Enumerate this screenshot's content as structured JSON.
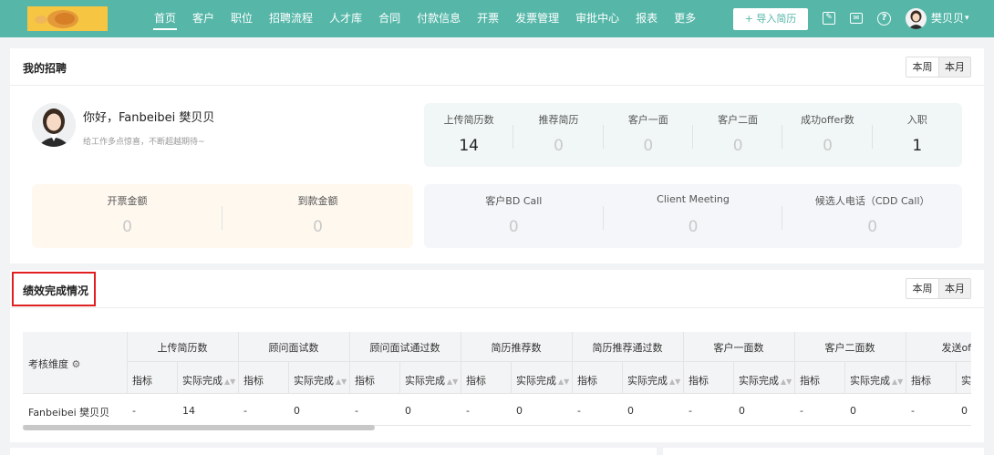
{
  "nav": {
    "items": [
      "首页",
      "客户",
      "职位",
      "招聘流程",
      "人才库",
      "合同",
      "付款信息",
      "开票",
      "发票管理",
      "审批中心",
      "报表",
      "更多"
    ],
    "active_index": 0,
    "import_label": "+ 导入简历",
    "user_name": "樊贝贝",
    "caret": "▾"
  },
  "recruit": {
    "title": "我的招聘",
    "toggle": [
      "本周",
      "本月"
    ],
    "greeting": "你好，Fanbeibei 樊贝贝",
    "slogan": "给工作多点惊喜，不断超越期待~",
    "top_stats": [
      {
        "label": "上传简历数",
        "value": "14"
      },
      {
        "label": "推荐简历",
        "value": "0"
      },
      {
        "label": "客户一面",
        "value": "0"
      },
      {
        "label": "客户二面",
        "value": "0"
      },
      {
        "label": "成功offer数",
        "value": "0"
      },
      {
        "label": "入职",
        "value": "1"
      }
    ],
    "money_stats": [
      {
        "label": "开票金额",
        "value": "0"
      },
      {
        "label": "到款金额",
        "value": "0"
      }
    ],
    "call_stats": [
      {
        "label": "客户BD Call",
        "value": "0"
      },
      {
        "label": "Client Meeting",
        "value": "0"
      },
      {
        "label": "候选人电话（CDD Call）",
        "value": "0"
      }
    ]
  },
  "performance": {
    "title": "绩效完成情况",
    "toggle": [
      "本周",
      "本月"
    ],
    "dimension_label": "考核维度",
    "groups": [
      "上传简历数",
      "顾问面试数",
      "顾问面试通过数",
      "简历推荐数",
      "简历推荐通过数",
      "客户一面数",
      "客户二面数",
      "发送offe"
    ],
    "sub_target": "指标",
    "sub_actual": "实际完成",
    "row_name": "Fanbeibei 樊贝贝",
    "row_targets": [
      "-",
      "-",
      "-",
      "-",
      "-",
      "-",
      "-",
      "-"
    ],
    "row_actuals": [
      "14",
      "0",
      "0",
      "0",
      "0",
      "0",
      "0",
      "0"
    ]
  },
  "colors": {
    "nav_bg": "#56b7a9",
    "teal_box": "#f1f7f6",
    "peach_box": "#fff8ef",
    "gray_box": "#f4f6f9",
    "highlight": "#e02020"
  }
}
